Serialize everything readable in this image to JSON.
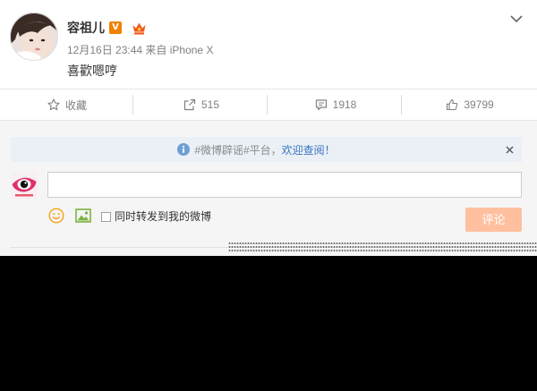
{
  "post": {
    "author": "容祖儿",
    "verified_badge": "V",
    "time": "12月16日 23:44",
    "source": "来自 iPhone X",
    "text": "喜歡嗯哼",
    "vip_icon": "crown-icon",
    "menu_icon": "chevron-down-icon"
  },
  "actions": [
    {
      "icon": "star-icon",
      "label": "收藏"
    },
    {
      "icon": "share-icon",
      "label": "515"
    },
    {
      "icon": "comment-icon",
      "label": "1918"
    },
    {
      "icon": "like-icon",
      "label": "39799"
    }
  ],
  "notice": {
    "icon": "info-icon",
    "text": "#微博辟谣#平台，",
    "link": "欢迎查阅！",
    "close_icon": "close-icon"
  },
  "composer": {
    "commenter_avatar_icon": "weibo-eye-logo-icon",
    "input_value": "",
    "emoji_icon": "smiley-icon",
    "image_icon": "picture-icon",
    "forward_checked": false,
    "forward_label": "同时转发到我的微博",
    "submit_label": "评论"
  },
  "colors": {
    "text": "#333333",
    "meta": "#808080",
    "verified": "#f08200",
    "vip": "#f25a1c",
    "link": "#3b74c0",
    "notice_bg": "#eaf0f6",
    "notice_text": "#8a8a8a",
    "submit_bg": "#ffc09f",
    "panel_bg": "#f5f5f5",
    "icon": "#808080"
  }
}
